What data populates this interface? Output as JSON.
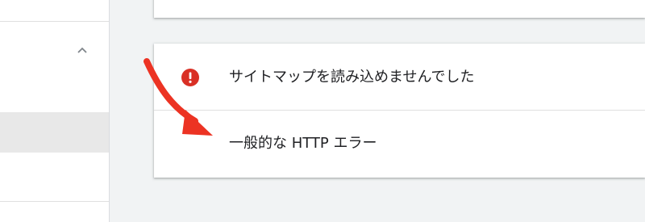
{
  "sidebar": {
    "chevron_icon": "chevron-up-icon"
  },
  "error_card": {
    "icon": "error-icon",
    "title": "サイトマップを読み込めませんでした",
    "detail": "一般的な HTTP エラー"
  },
  "annotation": {
    "arrow_color": "#ec3323"
  },
  "colors": {
    "error_red": "#d93025",
    "text": "#202124",
    "background": "#f1f3f4"
  }
}
